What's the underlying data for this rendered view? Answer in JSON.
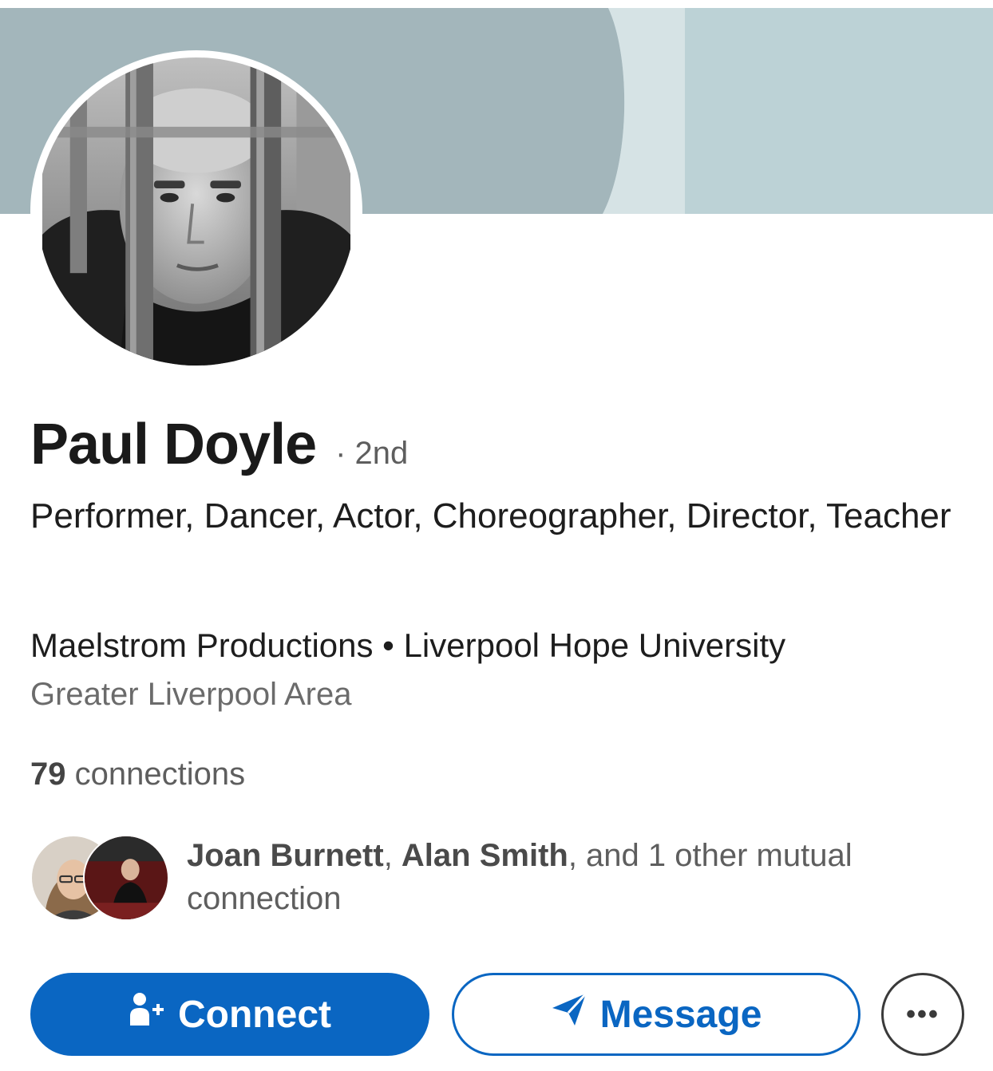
{
  "profile": {
    "name": "Paul Doyle",
    "degree": "· 2nd",
    "headline": "Performer, Dancer, Actor, Choreographer, Director, Teacher",
    "company": "Maelstrom Productions",
    "separator": "•",
    "school": "Liverpool Hope University",
    "location": "Greater Liverpool Area",
    "connections_count": "79",
    "connections_label": " connections"
  },
  "mutual": {
    "person1": "Joan Burnett",
    "sep1": ", ",
    "person2": "Alan Smith",
    "rest": ", and 1 other mutual connection"
  },
  "actions": {
    "connect_label": "Connect",
    "message_label": "Message",
    "more_label": "•••"
  },
  "icons": {
    "connect": "add-person-icon",
    "message": "send-icon",
    "more": "more-icon"
  },
  "colors": {
    "accent": "#0a66c2",
    "banner_dark": "#a3b6bb",
    "banner_light": "#bcd2d6",
    "banner_stripe": "#d6e3e5"
  }
}
